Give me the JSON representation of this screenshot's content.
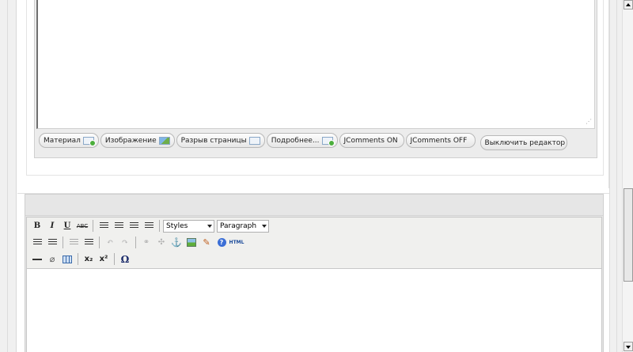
{
  "upper_editor": {
    "buttons": [
      {
        "label": "Материал",
        "icon": "article-icon"
      },
      {
        "label": "Изображение",
        "icon": "image-icon"
      },
      {
        "label": "Разрыв страницы",
        "icon": "pagebreak-icon"
      },
      {
        "label": "Подробнее...",
        "icon": "readmore-icon"
      },
      {
        "label": "JComments ON"
      },
      {
        "label": "JComments OFF"
      }
    ],
    "toggle_editor_label": "Выключить редактор"
  },
  "lower_editor": {
    "styles_select": "Styles",
    "format_select": "Paragraph",
    "toolbar": {
      "bold": "B",
      "italic": "I",
      "underline": "U",
      "strike": "ABC",
      "html": "HTML",
      "help": "?",
      "subscript": "x₂",
      "superscript": "x²",
      "omega": "Ω"
    }
  }
}
